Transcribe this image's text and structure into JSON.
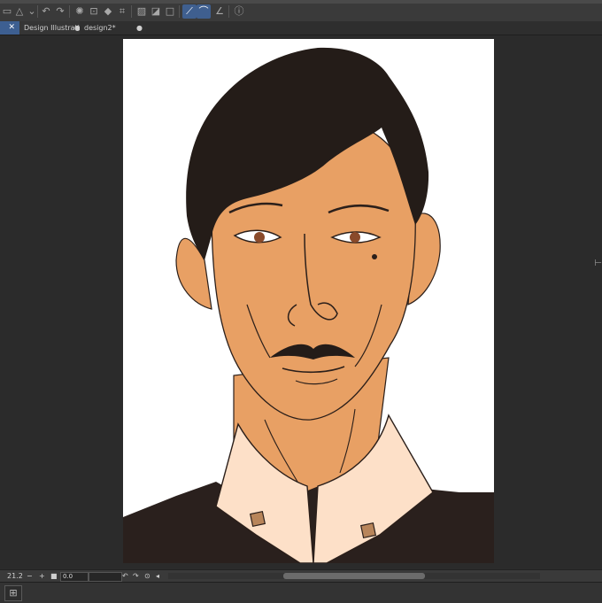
{
  "toolbar": {
    "icons": [
      "folder-icon",
      "cloud-icon",
      "undo-icon",
      "redo-icon",
      "loading-icon",
      "transform-icon",
      "fill-icon",
      "crop-icon",
      "selection-icon",
      "layer-icon",
      "frame-icon",
      "stabilizer-icon",
      "curve-icon",
      "ruler-icon",
      "help-icon"
    ]
  },
  "tabs": [
    {
      "label": "",
      "active": true
    },
    {
      "label": "Design Illustrati",
      "dot": "●"
    },
    {
      "label": "design2*",
      "dot": "●"
    }
  ],
  "bottombar": {
    "zoom_value": "21.2",
    "minus": "−",
    "plus": "+",
    "angle_value": "0.0"
  },
  "canvas": {
    "colors": {
      "skin": "#e8a064",
      "hair": "#241c18",
      "collar": "#fde0c8",
      "jacket": "#2a201d",
      "line": "#2b1f1a",
      "paper": "#ffffff"
    }
  }
}
